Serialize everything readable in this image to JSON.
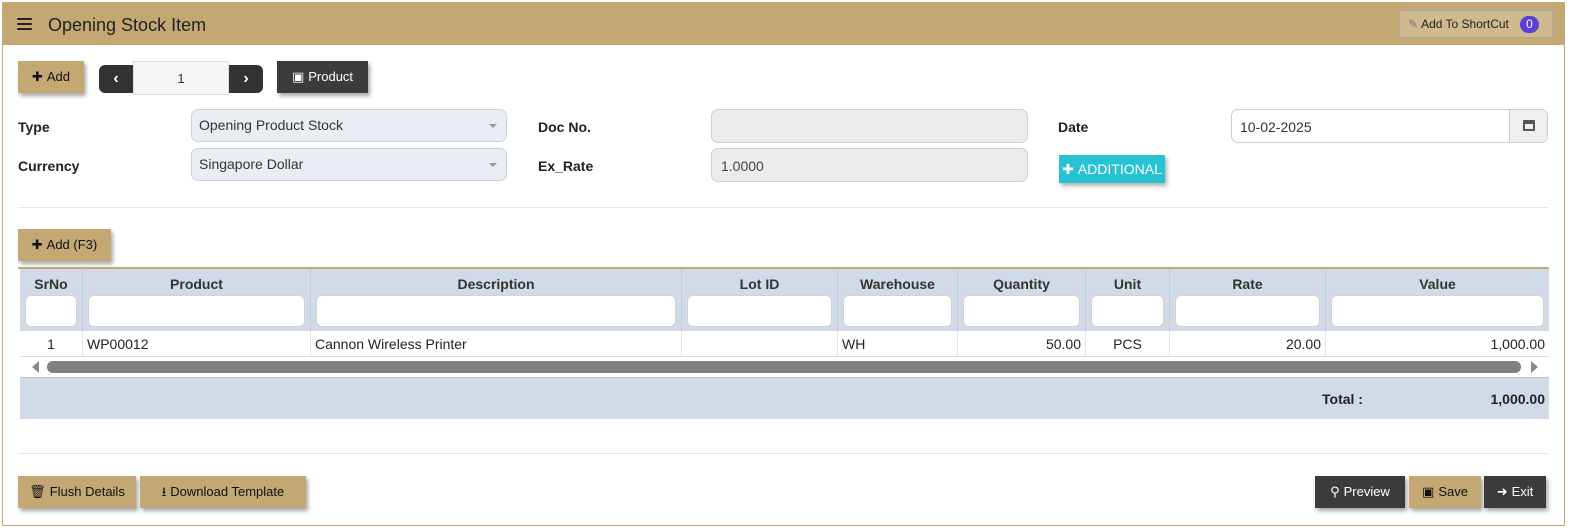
{
  "header": {
    "title": "Opening Stock Item",
    "shortcut_label": "Add To ShortCut",
    "shortcut_count": "0"
  },
  "toolbar": {
    "add_label": "Add",
    "record_number": "1",
    "product_label": "Product"
  },
  "form": {
    "type_label": "Type",
    "type_value": "Opening Product Stock",
    "currency_label": "Currency",
    "currency_value": "Singapore Dollar",
    "docno_label": "Doc No.",
    "docno_value": "",
    "exrate_label": "Ex_Rate",
    "exrate_value": "1.0000",
    "date_label": "Date",
    "date_value": "10-02-2025",
    "additional_label": "ADDITIONAL"
  },
  "grid": {
    "add_label": "Add (F3)",
    "columns": [
      "SrNo",
      "Product",
      "Description",
      "Lot ID",
      "Warehouse",
      "Quantity",
      "Unit",
      "Rate",
      "Value"
    ],
    "rows": [
      {
        "srno": "1",
        "product": "WP00012",
        "description": "Cannon Wireless Printer",
        "lot_id": "",
        "warehouse": "WH",
        "quantity": "50.00",
        "unit": "PCS",
        "rate": "20.00",
        "value": "1,000.00"
      }
    ],
    "total_label": "Total :",
    "total_value": "1,000.00"
  },
  "footer": {
    "flush_label": "Flush Details",
    "download_label": "Download Template",
    "preview_label": "Preview",
    "save_label": "Save",
    "exit_label": "Exit"
  },
  "colors": {
    "header_bg": "#c4a874",
    "dark_button": "#3b3b3b",
    "additional_button": "#26c3d3",
    "grid_header_bg": "#d0dbe7",
    "badge": "#5b3fd6"
  }
}
